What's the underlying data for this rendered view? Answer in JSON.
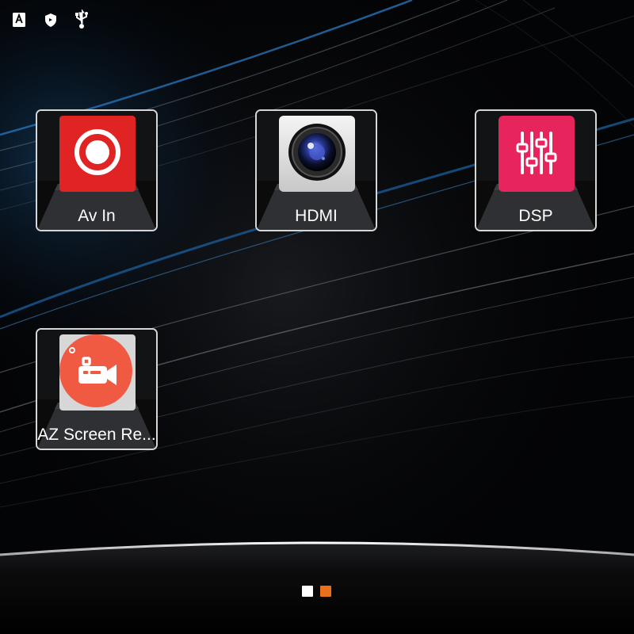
{
  "status_bar": {
    "icons": [
      "auto-rotate-icon",
      "shield-icon",
      "usb-icon"
    ]
  },
  "apps": [
    {
      "label": "Av In",
      "icon": "record-icon",
      "icon_color": "#e02424"
    },
    {
      "label": "HDMI",
      "icon": "camera-lens-icon",
      "icon_color": "#e8e8e8"
    },
    {
      "label": "DSP",
      "icon": "equalizer-icon",
      "icon_color": "#e8245c"
    },
    {
      "label": "AZ Screen Re...",
      "icon": "video-camera-icon",
      "icon_color": "#f05a42"
    }
  ],
  "pager": {
    "page_count": 2,
    "current_page": 2,
    "inactive_color": "#ffffff",
    "active_color": "#e8701a"
  },
  "colors": {
    "tile_border": "#d6d6d6",
    "wallpaper_streak": "#1a6fb5"
  }
}
